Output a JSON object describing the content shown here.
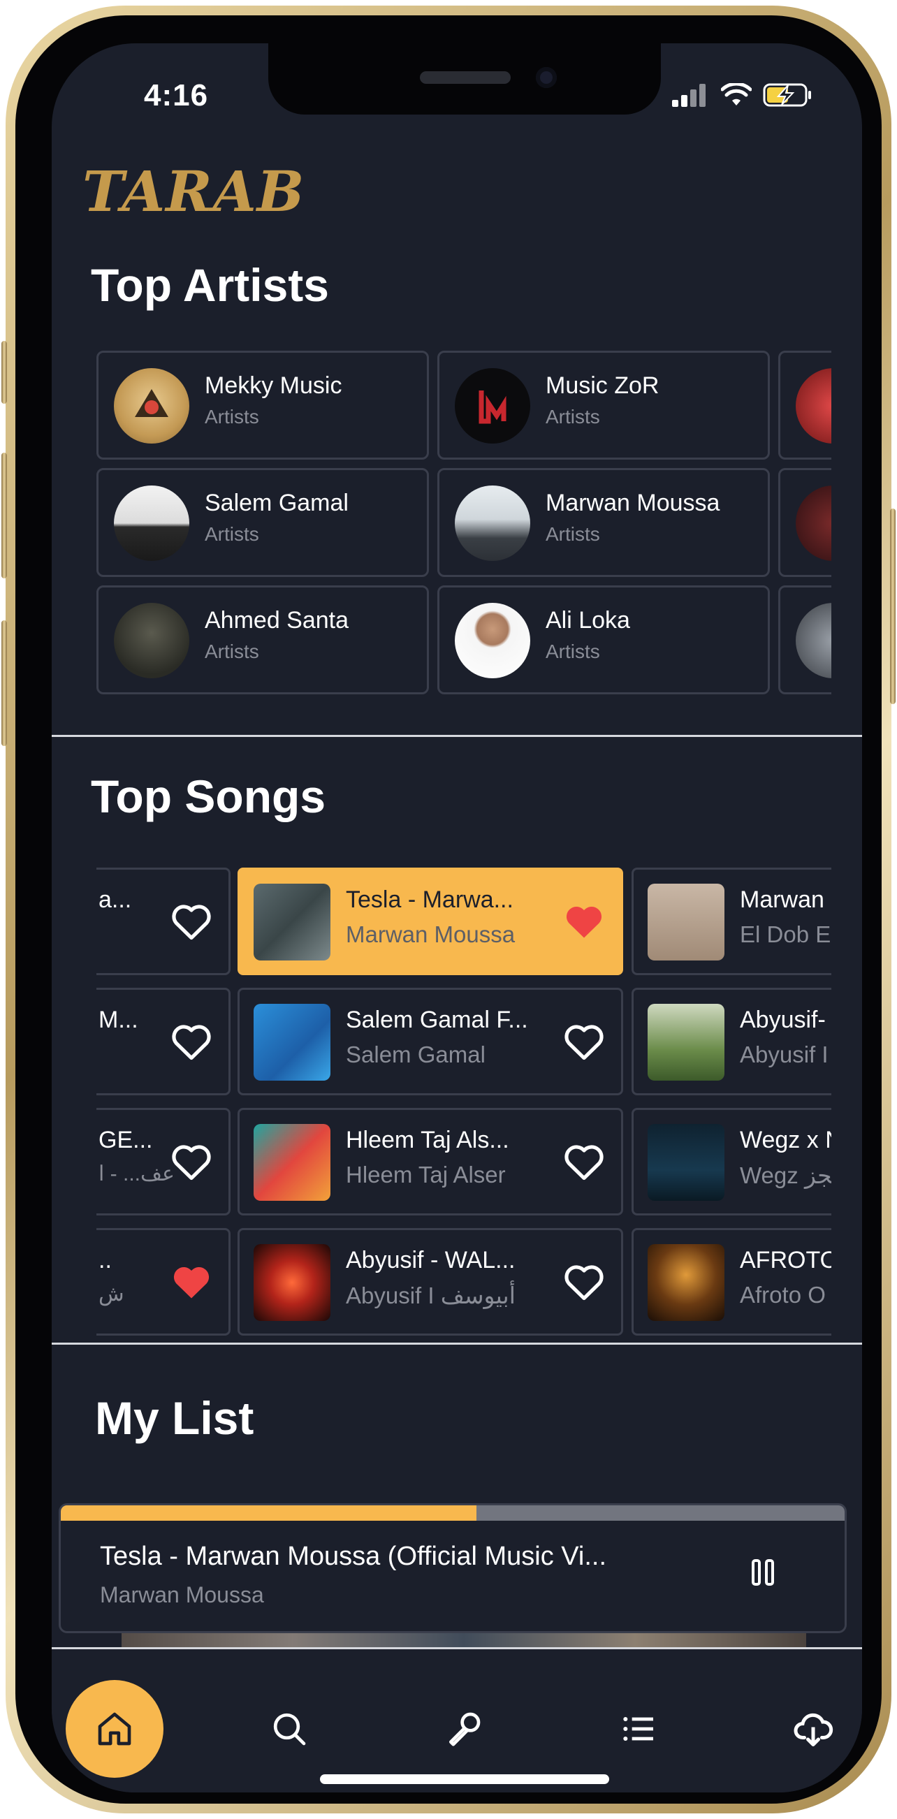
{
  "status_bar": {
    "time": "4:16"
  },
  "app": {
    "logo": "TARAB"
  },
  "top_artists": {
    "title": "Top Artists",
    "items": [
      {
        "name": "Mekky Music",
        "subtitle": "Artists"
      },
      {
        "name": "Music ZoR",
        "subtitle": "Artists"
      },
      {
        "name": "Salem Gamal",
        "subtitle": "Artists"
      },
      {
        "name": "Marwan Moussa",
        "subtitle": "Artists"
      },
      {
        "name": "Ahmed Santa",
        "subtitle": "Artists"
      },
      {
        "name": "Ali Loka",
        "subtitle": "Artists"
      }
    ]
  },
  "top_songs": {
    "title": "Top Songs",
    "col_left": [
      {
        "title": "a...",
        "artist": "",
        "liked": false
      },
      {
        "title": "M...",
        "artist": "",
        "liked": false
      },
      {
        "title": "GE...",
        "artist": "عف... - ا",
        "liked": false
      },
      {
        "title": "..",
        "artist": "ش",
        "liked": true
      }
    ],
    "col_center": [
      {
        "title": "Tesla - Marwa...",
        "artist": "Marwan Moussa",
        "liked": true,
        "active": true
      },
      {
        "title": "Salem Gamal F...",
        "artist": "Salem Gamal",
        "liked": false
      },
      {
        "title": "Hleem Taj Als...",
        "artist": "Hleem Taj Alser",
        "liked": false
      },
      {
        "title": "Abyusif - WAL...",
        "artist": "Abyusif I أبيوسف",
        "liked": false
      }
    ],
    "col_right": [
      {
        "title": "Marwan",
        "artist": "El Dob El"
      },
      {
        "title": "Abyusif-",
        "artist": "Abyusif I"
      },
      {
        "title": "Wegz x N",
        "artist": "Wegz ويجز"
      },
      {
        "title": "AFROTO",
        "artist": "Afroto O"
      }
    ]
  },
  "my_list": {
    "title": "My List"
  },
  "player": {
    "title": "Tesla - Marwan Moussa (Official Music Vi...",
    "artist": "Marwan Moussa",
    "progress": 0.53,
    "state": "playing"
  },
  "nav": {
    "active": "home",
    "items": [
      "home-icon",
      "search-icon",
      "microphone-icon",
      "list-icon",
      "cloud-download-icon"
    ]
  },
  "colors": {
    "accent": "#f8b84e",
    "background": "#1b1f2b",
    "logo": "#c59a4c",
    "heart": "#ef4444"
  }
}
